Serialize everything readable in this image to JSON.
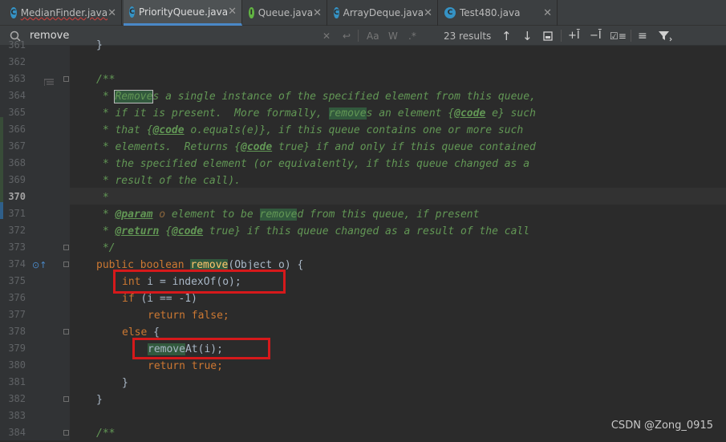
{
  "tabs": [
    {
      "label": "MedianFinder.java",
      "icon": "class-icon",
      "color": "#3592c4",
      "active": false
    },
    {
      "label": "PriorityQueue.java",
      "icon": "class-icon",
      "color": "#3592c4",
      "active": true
    },
    {
      "label": "Queue.java",
      "icon": "interface-icon",
      "color": "#62b543",
      "active": false
    },
    {
      "label": "ArrayDeque.java",
      "icon": "class-icon",
      "color": "#3592c4",
      "active": false
    },
    {
      "label": "Test480.java",
      "icon": "class-icon",
      "color": "#3592c4",
      "active": false
    }
  ],
  "search": {
    "query": "remove",
    "results": "23 results",
    "match_case": "Aa",
    "words": "W",
    "regex": ".*"
  },
  "lines": [
    "361",
    "362",
    "363",
    "364",
    "365",
    "366",
    "367",
    "368",
    "369",
    "370",
    "371",
    "372",
    "373",
    "374",
    "375",
    "376",
    "377",
    "378",
    "379",
    "380",
    "381",
    "382",
    "383",
    "384"
  ],
  "code": {
    "l363": "/**",
    "l364a": " * ",
    "l364b": "Remove",
    "l364c": "s a single instance of the specified element from this queue,",
    "l365a": " * if it is present.  More formally, ",
    "l365b": "remove",
    "l365c": "s an element {",
    "l365d": "@code",
    "l365e": " e} such",
    "l366a": " * that {",
    "l366b": "@code",
    "l366c": " o.equals(e)}, if this queue contains one or more such",
    "l367a": " * elements.  Returns {",
    "l367b": "@code",
    "l367c": " true} if and only if this queue contained",
    "l368": " * the specified element (or equivalently, if this queue changed as a",
    "l369": " * result of the call).",
    "l370": " *",
    "l371a": " * ",
    "l371b": "@param",
    "l371c": " o",
    "l371d": " element to be ",
    "l371e": "remove",
    "l371f": "d from this queue, if present",
    "l372a": " * ",
    "l372b": "@return",
    "l372c": " {",
    "l372d": "@code",
    "l372e": " true} if this queue changed as a result of the call",
    "l373": " */",
    "l374a": "public boolean ",
    "l374b": "remove",
    "l374c": "(Object o) {",
    "l375a": "int",
    "l375b": " i = indexOf(o);",
    "l376a": "if",
    "l376b": " (i == -1)",
    "l377a": "return false",
    "l377b": ";",
    "l378a": "else",
    "l378b": " {",
    "l379a": "remove",
    "l379b": "At(i);",
    "l380a": "return true",
    "l380b": ";",
    "l381": "}",
    "l382": "}",
    "l384": "/**"
  },
  "watermark": "CSDN @Zong_0915",
  "colors": {
    "background": "#2b2b2b",
    "doc_comment": "#629755",
    "keyword": "#cc7832",
    "method": "#ffc66d",
    "highlight": "#32593d",
    "annotation_box": "#d6191b"
  }
}
